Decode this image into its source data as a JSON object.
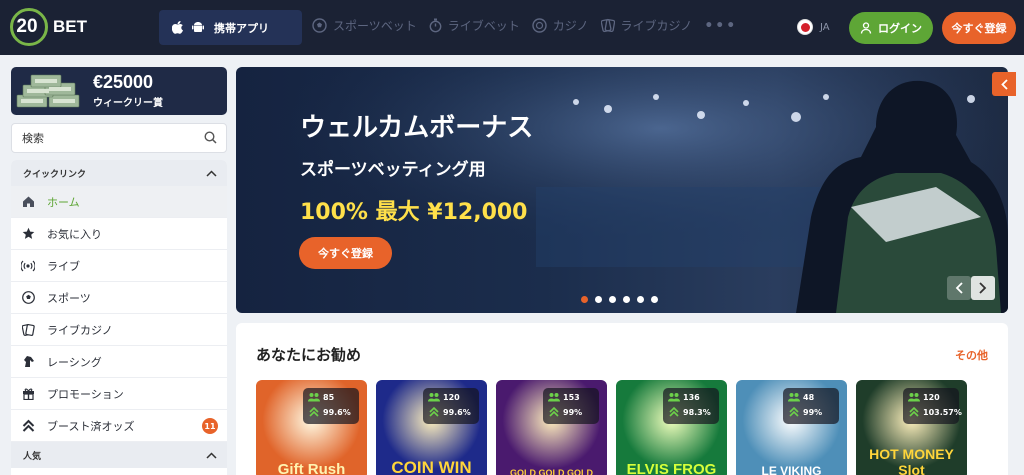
{
  "header": {
    "logo_number": "20",
    "logo_text": "BET",
    "app_button": "携帯アプリ",
    "nav": [
      {
        "label": "スポーツベット",
        "icon": "soccer-ball-icon"
      },
      {
        "label": "ライブベット",
        "icon": "stopwatch-icon"
      },
      {
        "label": "カジノ",
        "icon": "casino-chip-icon"
      },
      {
        "label": "ライブカジノ",
        "icon": "cards-icon"
      }
    ],
    "more": "•••",
    "language": "JA",
    "login": "ログイン",
    "signup": "今すぐ登録"
  },
  "sidebar": {
    "promo_amount": "€25000",
    "promo_label": "ウィークリー賞",
    "search_placeholder": "検索",
    "quick_links_header": "クイックリンク",
    "items": [
      {
        "label": "ホーム",
        "icon": "home-icon"
      },
      {
        "label": "お気に入り",
        "icon": "star-icon"
      },
      {
        "label": "ライブ",
        "icon": "live-broadcast-icon"
      },
      {
        "label": "スポーツ",
        "icon": "soccer-ball-icon"
      },
      {
        "label": "ライブカジノ",
        "icon": "cards-icon"
      },
      {
        "label": "レーシング",
        "icon": "horse-icon"
      },
      {
        "label": "プロモーション",
        "icon": "gift-icon"
      },
      {
        "label": "ブースト済オッズ",
        "icon": "double-chevron-up-icon",
        "badge": "11"
      }
    ],
    "popular_header": "人気"
  },
  "banner": {
    "title": "ウェルカムボーナス",
    "subtitle": "スポーツベッティング用",
    "amount": "100% 最大 ¥12,000",
    "cta": "今すぐ登録",
    "slide_count": 6,
    "active_slide": 1
  },
  "games": {
    "title": "あなたにお勧め",
    "more": "その他",
    "items": [
      {
        "name": "Gift Rush",
        "players": "85",
        "rtp": "99.6%",
        "bg": "#e0642a",
        "fg": "#fff3b0"
      },
      {
        "name": "COIN WIN",
        "players": "120",
        "rtp": "99.6%",
        "bg": "#1e2a8a",
        "fg": "#ffd53a"
      },
      {
        "name": "GOLD GOLD GOLD",
        "players": "153",
        "rtp": "99%",
        "bg": "#4a1a6e",
        "fg": "#ffcf3a"
      },
      {
        "name": "ELVIS FROG",
        "players": "136",
        "rtp": "98.3%",
        "bg": "#167a3c",
        "fg": "#d6ff3a"
      },
      {
        "name": "LE VIKING",
        "players": "48",
        "rtp": "99%",
        "bg": "#4e8fb8",
        "fg": "#ffffff"
      },
      {
        "name": "HOT MONEY Slot",
        "players": "120",
        "rtp": "103.57%",
        "bg": "#1f3d2a",
        "fg": "#ffd53a"
      }
    ]
  }
}
